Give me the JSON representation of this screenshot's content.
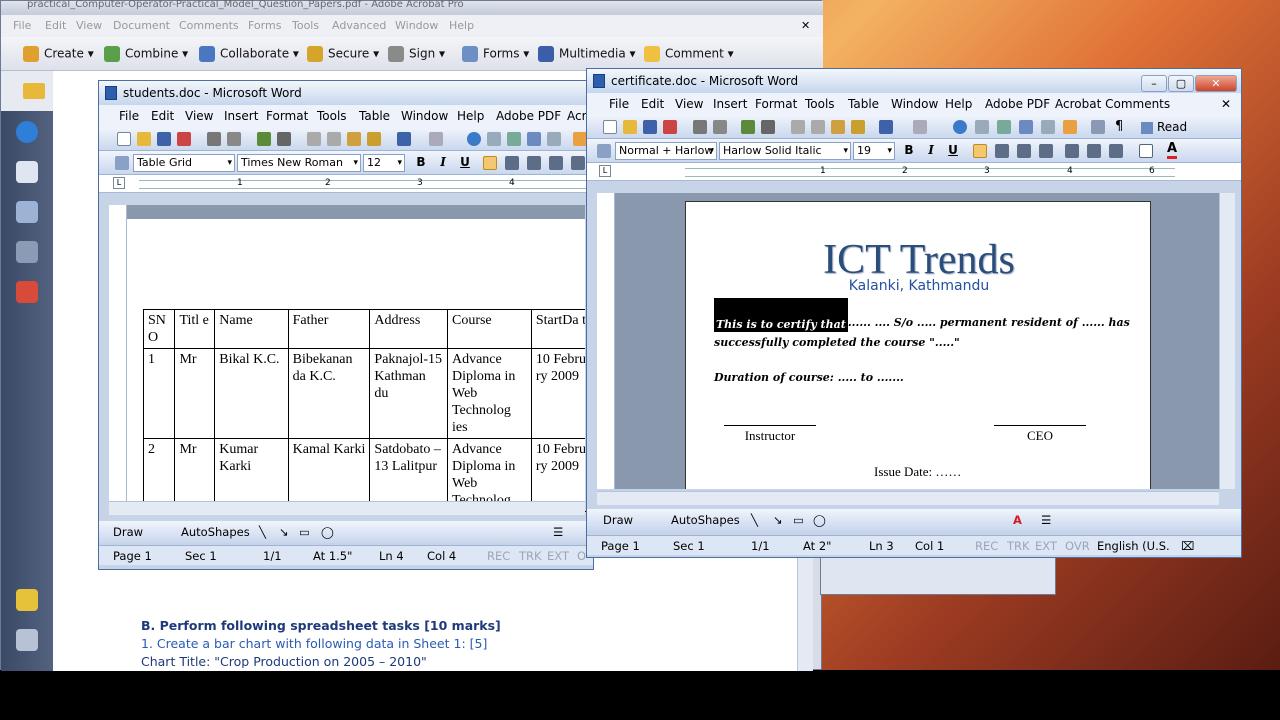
{
  "acrobat": {
    "title": "practical_Computer-Operator-Practical_Model_Question_Papers.pdf - Adobe Acrobat Pro",
    "menu": [
      "File",
      "Edit",
      "View",
      "Document",
      "Comments",
      "Forms",
      "Tools",
      "Advanced",
      "Window",
      "Help"
    ],
    "toolbar": [
      "Create",
      "Combine",
      "Collaborate",
      "Secure",
      "Sign",
      "Forms",
      "Multimedia",
      "Comment"
    ],
    "pdf": {
      "heading": "B. Perform following spreadsheet tasks [10 marks]",
      "line1": "1. Create a bar chart with following data in Sheet 1:  [5]",
      "line2": "Chart Title: \"Crop Production on 2005 – 2010\""
    }
  },
  "students": {
    "title": "students.doc - Microsoft Word",
    "menu": [
      "File",
      "Edit",
      "View",
      "Insert",
      "Format",
      "Tools",
      "Table",
      "Window",
      "Help",
      "Adobe PDF",
      "Acr"
    ],
    "style": "Table Grid",
    "font": "Times New Roman",
    "size": "12",
    "headers": [
      "SN O",
      "Titl e",
      "Name",
      "Father",
      "Address",
      "Course",
      "StartDa te"
    ],
    "rows": [
      [
        "1",
        "Mr",
        "Bikal K.C.",
        "Bibekanan da K.C.",
        "Paknajol-15 Kathman du",
        "Advance Diploma in Web Technolog ies",
        "10 Februa ry 2009"
      ],
      [
        "2",
        "Mr",
        "Kumar Karki",
        "Kamal Karki",
        "Satdobato – 13 Lalitpur",
        "Advance Diploma in Web Technolog",
        "10 Februa ry 2009"
      ]
    ],
    "draw": {
      "draw": "Draw",
      "autoshapes": "AutoShapes"
    },
    "status": {
      "page": "Page 1",
      "sec": "Sec 1",
      "pages": "1/1",
      "at": "At 1.5\"",
      "ln": "Ln 4",
      "col": "Col 4",
      "rec": "REC",
      "trk": "TRK",
      "ext": "EXT",
      "ovr": "O"
    }
  },
  "certificate": {
    "title": "certificate.doc - Microsoft Word",
    "menu": [
      "File",
      "Edit",
      "View",
      "Insert",
      "Format",
      "Tools",
      "Table",
      "Window",
      "Help",
      "Adobe PDF",
      "Acrobat Comments"
    ],
    "read": "Read",
    "style": "Normal + Harlow",
    "font": "Harlow Solid Italic",
    "size": "19",
    "doc": {
      "heading": "ICT Trends",
      "sub": "Kalanki, Kathmandu",
      "selected": "This is to certify that",
      "line1_rest": "......  ....  S/o  ..... permanent resident of ...... has",
      "line2": "successfully completed the course \".....\"",
      "duration": "Duration of course:  .....  to  .......",
      "instructor": "Instructor",
      "ceo": "CEO",
      "issue": "Issue Date: ……"
    },
    "draw": {
      "draw": "Draw",
      "autoshapes": "AutoShapes"
    },
    "status": {
      "page": "Page 1",
      "sec": "Sec 1",
      "pages": "1/1",
      "at": "At 2\"",
      "ln": "Ln 3",
      "col": "Col 1",
      "rec": "REC",
      "trk": "TRK",
      "ext": "EXT",
      "ovr": "OVR",
      "lang": "English (U.S."
    }
  }
}
